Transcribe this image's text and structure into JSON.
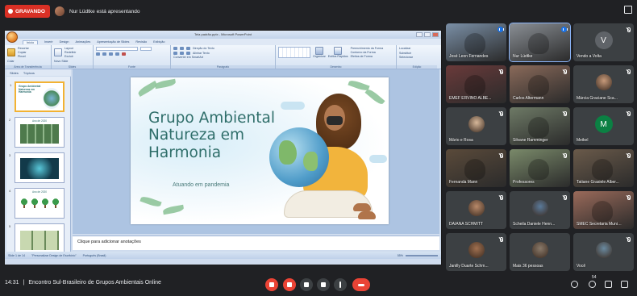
{
  "top": {
    "recording_label": "GRAVANDO",
    "presenting_text": "Nur Lüdtke está apresentando"
  },
  "ppt": {
    "window_title": "Tela padrão.pptx - Microsoft PowerPoint",
    "tabs": [
      "Início",
      "Inserir",
      "Design",
      "Animações",
      "Apresentação de Slides",
      "Revisão",
      "Exibição"
    ],
    "groups": [
      "Área de Transferência",
      "Slides",
      "Fonte",
      "Parágrafo",
      "Desenho",
      "Edição"
    ],
    "ribbon_items": {
      "paste": "Colar",
      "cut": "Recortar",
      "copy": "Copiar",
      "format_painter": "Pincel",
      "new_slide": "Novo Slide",
      "layout": "Layout",
      "reset": "Redefinir",
      "delete": "Excluir",
      "text_direction": "Direção do Texto",
      "align_text": "Alinhar Texto",
      "smartart": "Converter em SmartArt",
      "arrange": "Organizar",
      "quick_styles": "Estilos Rápidos",
      "shape_fill": "Preenchimento da Forma",
      "shape_outline": "Contorno da Forma",
      "shape_effects": "Efeitos de Forma",
      "find": "Localizar",
      "replace": "Substituir",
      "select": "Selecionar"
    },
    "panel_tabs": [
      "Slides",
      "Tópicos"
    ],
    "thumbnails": [
      {
        "num": "1",
        "title": "Grupo Ambiental Natureza em Harmonia"
      },
      {
        "num": "2",
        "title": "Ano de 2020"
      },
      {
        "num": "3",
        "title": ""
      },
      {
        "num": "4",
        "title": "Ano de 2020"
      },
      {
        "num": "5",
        "title": ""
      }
    ],
    "slide": {
      "title_lines": [
        "Grupo Ambiental",
        "Natureza em",
        "Harmonia"
      ],
      "subtitle": "Atuando em pandemia"
    },
    "notes_placeholder": "Clique para adicionar anotações",
    "status": {
      "slide_count": "Slide 1 de 14",
      "theme": "\"Personalizar Design de Escritório\"",
      "language": "Português (Brasil)",
      "zoom": "55%"
    }
  },
  "participants": [
    {
      "name": "José Leon Fernandes",
      "mic": "on",
      "bg": "#7a8fa6"
    },
    {
      "name": "Nur Lüdtke",
      "mic": "on",
      "bg": "#8a8f95",
      "active": true
    },
    {
      "name": "Vendo a Volta",
      "mic": "off",
      "letter": "V",
      "letter_color": "#5f6368"
    },
    {
      "name": "EMEF ERVINO ALBE...",
      "mic": "off",
      "bg": "#6a3a3a"
    },
    {
      "name": "Carlos Altermann",
      "mic": "off",
      "bg": "#8a6a5a"
    },
    {
      "name": "Márcia Graciane Sca...",
      "mic": "off",
      "avatar": "#c79a7a"
    },
    {
      "name": "Mário e Rosa",
      "mic": "off",
      "avatar": "#d7b89a"
    },
    {
      "name": "Silvane Ramminger",
      "mic": "off",
      "bg": "#6e7a66"
    },
    {
      "name": "Meikel",
      "mic": "off",
      "letter": "M",
      "letter_color": "#0b8043"
    },
    {
      "name": "Fernanda Mann",
      "mic": "off",
      "bg": "#5a4a3a"
    },
    {
      "name": "Professores",
      "mic": "off",
      "bg": "#7a8a6a"
    },
    {
      "name": "Tatiane Grasiele Alber...",
      "mic": "off",
      "bg": "#6a5a4a"
    },
    {
      "name": "DAIANA SCHMITT",
      "mic": "off",
      "avatar": "#b98a6a"
    },
    {
      "name": "Scheila Daniele Henn...",
      "mic": "off",
      "avatar": "#5a7a9a"
    },
    {
      "name": "SMEC Secretaria Munic...",
      "mic": "off",
      "bg": "#9a6a5a"
    },
    {
      "name": "Janilly Duarte Schm...",
      "mic": "off",
      "avatar": "#a07050"
    },
    {
      "name": "Mais 36 pessoas",
      "mic": "",
      "avatar": "#8a7a6a"
    },
    {
      "name": "Você",
      "mic": "off",
      "avatar": "#6a8aa0"
    }
  ],
  "bottom": {
    "time": "14:31",
    "separator": "|",
    "meeting_title": "Encontro Sul-Brasileiro de Grupos Ambientais Online",
    "participant_count": "54"
  }
}
